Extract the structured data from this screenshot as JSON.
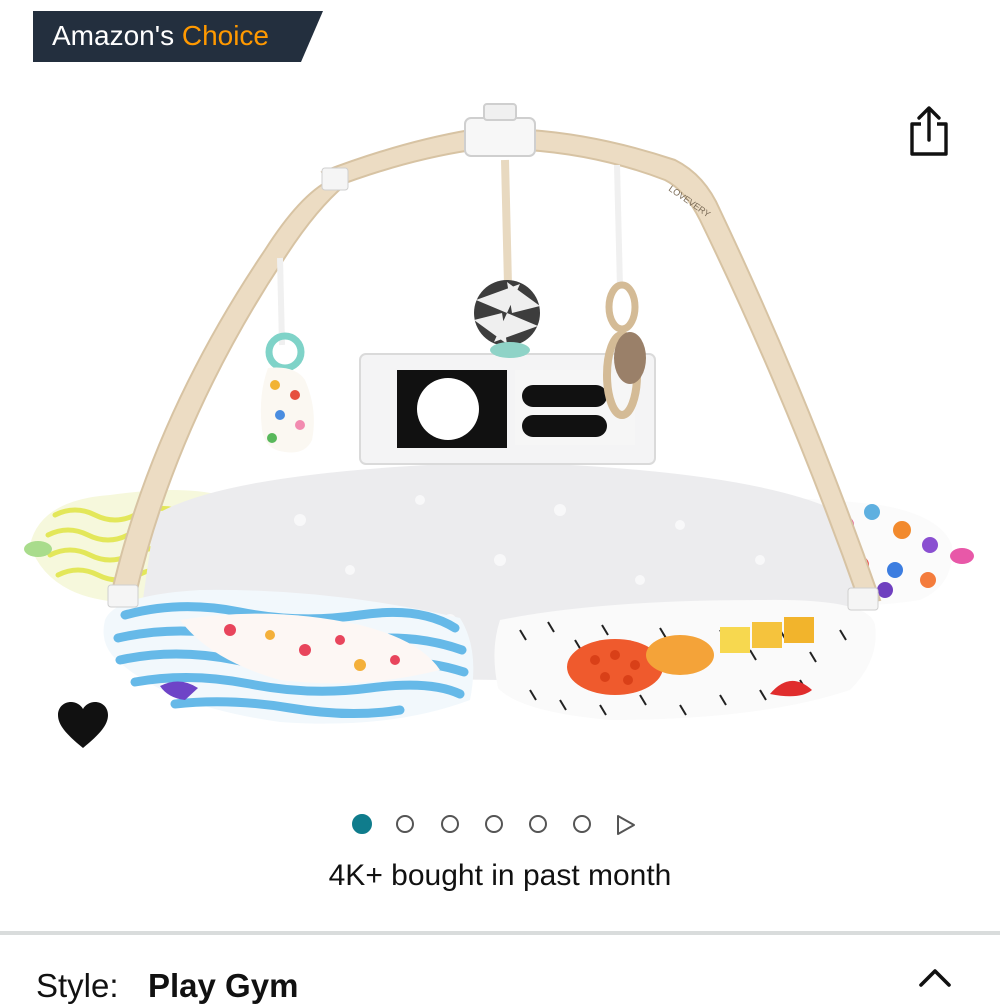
{
  "badge": {
    "prefix": "Amazon's",
    "accent": "Choice",
    "bg_color": "#232f3e",
    "accent_color": "#ff9900"
  },
  "icons": {
    "share": "share-icon",
    "wishlist": "heart-icon",
    "expand": "chevron-up-icon",
    "play": "play-triangle-icon"
  },
  "product_image": {
    "brand_text": "LOVEVERY"
  },
  "carousel": {
    "total": 6,
    "active_index": 0,
    "active_color": "#0f7c8c"
  },
  "social_proof": {
    "text": "4K+ bought in past month"
  },
  "style": {
    "label": "Style:",
    "value": "Play Gym"
  }
}
